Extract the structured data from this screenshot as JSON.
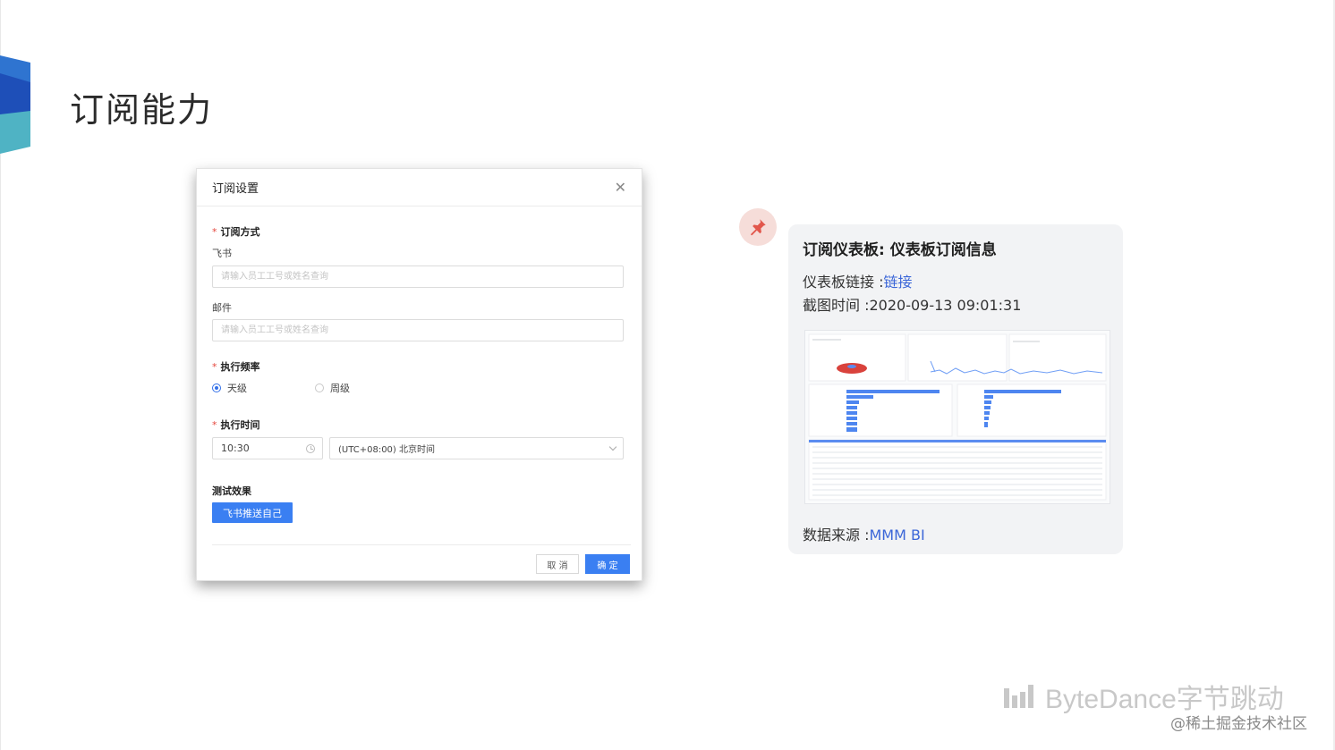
{
  "slide": {
    "title": "订阅能力",
    "colors": {
      "ribbon_dark": "#1e4fb8",
      "ribbon_mid": "#2f74d0",
      "ribbon_teal": "#4fb3c4"
    }
  },
  "dialog": {
    "title": "订阅设置",
    "close_icon": "close-icon",
    "subscribe_method_label": "订阅方式",
    "feishu_label": "飞书",
    "feishu_placeholder": "请输入员工工号或姓名查询",
    "email_label": "邮件",
    "email_placeholder": "请输入员工工号或姓名查询",
    "frequency_label": "执行频率",
    "frequency_options": [
      {
        "label": "天级",
        "selected": true
      },
      {
        "label": "周级",
        "selected": false
      }
    ],
    "exec_time_label": "执行时间",
    "time_value": "10:30",
    "timezone_value": "(UTC+08:00) 北京时间",
    "test_label": "测试效果",
    "push_button_label": "飞书推送自己",
    "cancel_label": "取 消",
    "ok_label": "确 定",
    "colors": {
      "primary": "#3a7ff2",
      "required": "#e5473e"
    }
  },
  "message": {
    "title": "订阅仪表板: 仪表板订阅信息",
    "dashboard_link_prefix": "仪表板链接 :",
    "dashboard_link_text": "链接",
    "capture_time": "截图时间 :2020-09-13 09:01:31",
    "source_prefix": "数据来源 :",
    "source_text": "MMM BI",
    "pin_icon": "pushpin-icon",
    "colors": {
      "link": "#3b66d8",
      "card_bg": "#f2f3f5",
      "pin_bg": "#f6ddd9",
      "pin": "#e2574c"
    }
  },
  "branding": {
    "logo_text": "ByteDance字节跳动",
    "credit": "@稀土掘金技术社区"
  }
}
